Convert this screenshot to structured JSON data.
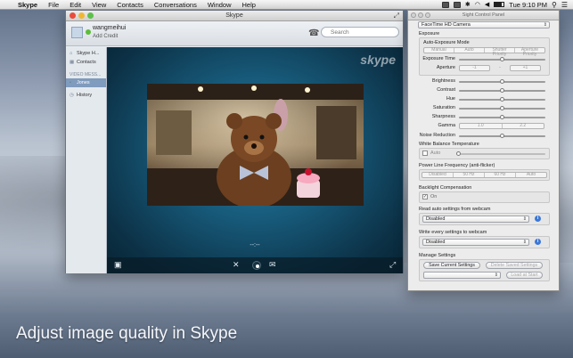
{
  "menubar": {
    "app_name": "Skype",
    "items": [
      "File",
      "Edit",
      "View",
      "Contacts",
      "Conversations",
      "Window",
      "Help"
    ],
    "clock": "Tue 9:10 PM"
  },
  "skype": {
    "window_title": "Skype",
    "username": "wangmeihui",
    "add_credit": "Add Credit",
    "search_placeholder": "Search",
    "sidebar": {
      "home": "Skype H...",
      "contacts": "Contacts",
      "section_label": "VIDEO MESS...",
      "selected_contact": "Jones",
      "history": "History"
    },
    "call_timer": "--:--"
  },
  "control_panel": {
    "title": "Sight Control Panel",
    "camera": "FaceTime HD Camera",
    "exposure_header": "Exposure",
    "auto_exposure_mode": "Auto-Exposure Mode",
    "ae_modes": [
      "Manual",
      "Auto",
      "Shutter Priority",
      "Aperture Priority"
    ],
    "exposure_time": "Exposure Time",
    "aperture": "Aperture",
    "aperture_values": [
      "-1",
      "+1"
    ],
    "aperture_mid": "-",
    "brightness": "Brightness",
    "contrast": "Contrast",
    "hue": "Hue",
    "saturation": "Saturation",
    "sharpness": "Sharpness",
    "gamma": "Gamma",
    "gamma_values": [
      "1.0",
      "2.2"
    ],
    "noise_reduction": "Noise Reduction",
    "white_balance": "White Balance Temperature",
    "auto_label": "Auto",
    "power_line": "Power Line Frequency (anti-flicker)",
    "power_modes": [
      "Disabled",
      "50 Hz",
      "60 Hz",
      "Auto"
    ],
    "backlight": "Backlight Compensation",
    "on_label": "On",
    "read_auto": "Read auto settings from webcam",
    "read_auto_value": "Disabled",
    "write_every": "Write every settings to webcam",
    "write_every_value": "Disabled",
    "manage": "Manage Settings",
    "save_current": "Save Current Settings",
    "delete_saved": "Delete Saved Settings",
    "load_at_start": "Load at Start",
    "slider_levels": {
      "exposure_time": 0.5,
      "brightness": 0.5,
      "contrast": 0.5,
      "hue": 0.5,
      "saturation": 0.5,
      "sharpness": 0.5,
      "noise_reduction": 0.5,
      "white_balance": 0.0
    }
  },
  "caption": "Adjust image quality in Skype"
}
